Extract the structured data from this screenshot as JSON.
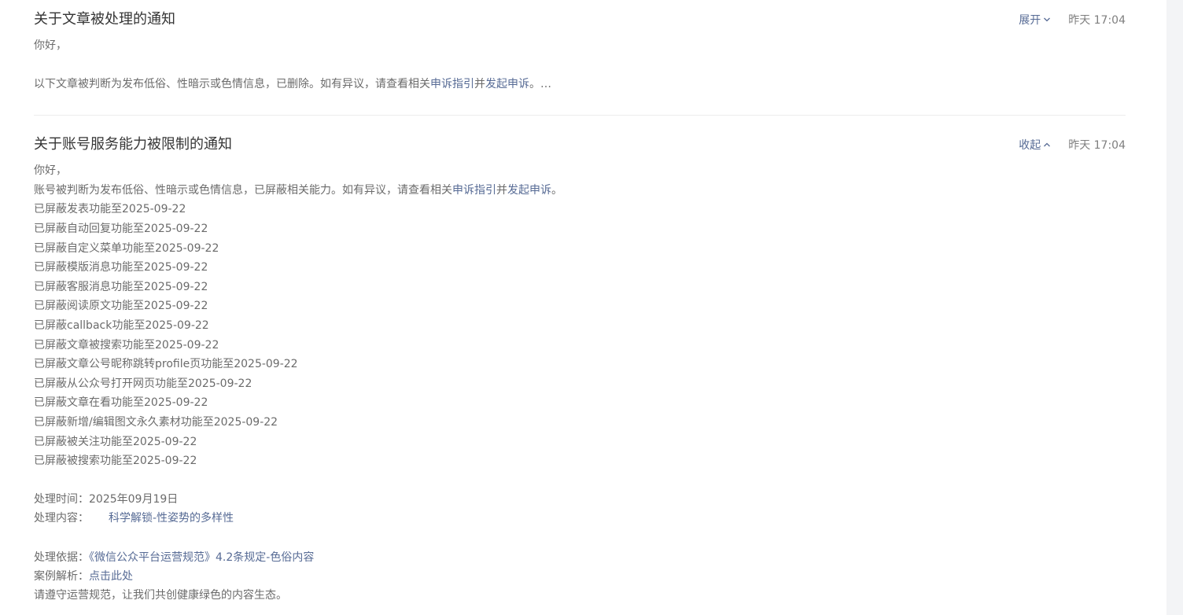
{
  "notices": [
    {
      "title": "关于文章被处理的通知",
      "toggle_label": "展开",
      "time": "昨天 17:04",
      "greeting": "你好，",
      "summary": "以下文章被判断为发布低俗、性暗示或色情信息，已删除。如有异议，请查看相关",
      "appeal_link": "申诉指引",
      "summary_mid": "并",
      "appeal_action": "发起申诉",
      "summary_end": "。…"
    },
    {
      "title": "关于账号服务能力被限制的通知",
      "toggle_label": "收起",
      "time": "昨天 17:04",
      "greeting": "你好，",
      "summary": "账号被判断为发布低俗、性暗示或色情信息，已屏蔽相关能力。如有异议，请查看相关",
      "appeal_link": "申诉指引",
      "summary_mid": "并",
      "appeal_action": "发起申诉",
      "summary_end": "。",
      "restrictions": [
        "已屏蔽发表功能至2025-09-22",
        "已屏蔽自动回复功能至2025-09-22",
        "已屏蔽自定义菜单功能至2025-09-22",
        "已屏蔽模版消息功能至2025-09-22",
        "已屏蔽客服消息功能至2025-09-22",
        "已屏蔽阅读原文功能至2025-09-22",
        "已屏蔽callback功能至2025-09-22",
        "已屏蔽文章被搜索功能至2025-09-22",
        "已屏蔽文章公号昵称跳转profile页功能至2025-09-22",
        "已屏蔽从公众号打开网页功能至2025-09-22",
        "已屏蔽文章在看功能至2025-09-22",
        "已屏蔽新增/编辑图文永久素材功能至2025-09-22",
        "已屏蔽被关注功能至2025-09-22",
        "已屏蔽被搜索功能至2025-09-22"
      ],
      "process_time_label": "处理时间：",
      "process_time": "2025年09月19日",
      "process_content_label": "处理内容：",
      "process_content_link": "科学解锁-性姿势的多样性",
      "basis_label": "处理依据：",
      "basis_link": "《微信公众平台运营规范》4.2条规定-色俗内容",
      "case_label": "案例解析：",
      "case_link": "点击此处",
      "closing": "请遵守运营规范，让我们共创健康绿色的内容生态。"
    }
  ],
  "colors": {
    "link": "#576b95",
    "body_text": "#6b6b6b",
    "title_text": "#353535",
    "divider": "#ececec"
  },
  "icons": {
    "expand": "chevron-down-icon",
    "collapse": "chevron-up-icon"
  }
}
